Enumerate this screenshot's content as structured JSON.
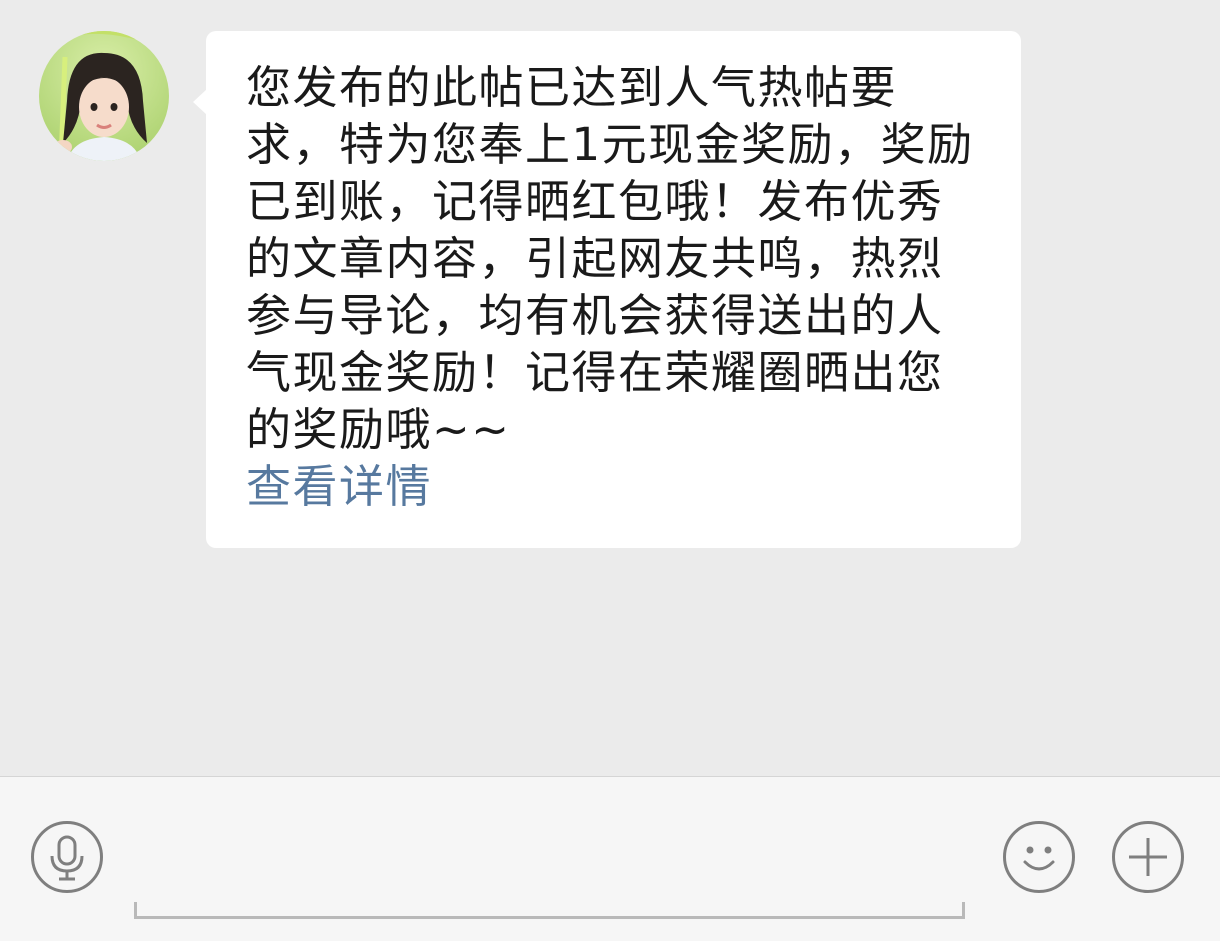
{
  "message": {
    "text": "您发布的此帖已达到人气热帖要求，特为您奉上1元现金奖励，奖励已到账，记得晒红包哦！发布优秀的文章内容，引起网友共鸣，热烈参与导论，均有机会获得送出的人气现金奖励！记得在荣耀圈晒出您的奖励哦~~",
    "link_label": "查看详情"
  },
  "input_bar": {
    "text_value": "",
    "voice_icon": "microphone-icon",
    "emoji_icon": "smiley-icon",
    "more_icon": "plus-icon"
  },
  "colors": {
    "chat_background": "#ebebeb",
    "bubble": "#ffffff",
    "link": "#57799f",
    "input_bar_background": "#f6f6f6",
    "icon_stroke": "#7f7f7f"
  }
}
